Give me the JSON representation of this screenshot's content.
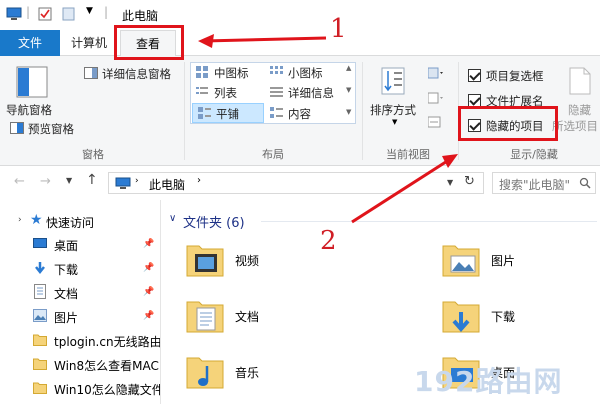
{
  "titlebar": {
    "title": "此电脑"
  },
  "tabs": {
    "file": "文件",
    "computer": "计算机",
    "view": "查看"
  },
  "ribbon": {
    "panes": {
      "nav_pane": "导航窗格",
      "preview_pane": "预览窗格",
      "details_pane": "详细信息窗格",
      "group_label": "窗格"
    },
    "layout": {
      "items": [
        "中图标",
        "小图标",
        "列表",
        "详细信息",
        "平铺",
        "内容"
      ],
      "selected": "平铺",
      "group_label": "布局"
    },
    "current_view": {
      "sort_by": "排序方式",
      "group_label": "当前视图"
    },
    "show_hide": {
      "item_checkboxes": "项目复选框",
      "file_extensions": "文件扩展名",
      "hidden_items": "隐藏的项目",
      "hide_label": "隐藏",
      "hide_selected_label": "所选项目",
      "group_label": "显示/隐藏"
    }
  },
  "address": {
    "path": "此电脑",
    "search_placeholder": "搜索\"此电脑\""
  },
  "nav": {
    "quick_access": "快速访问",
    "items": [
      {
        "label": "桌面",
        "pinned": true
      },
      {
        "label": "下载",
        "pinned": true
      },
      {
        "label": "文档",
        "pinned": true
      },
      {
        "label": "图片",
        "pinned": true
      },
      {
        "label": "tplogin.cn无线路由",
        "pinned": false
      },
      {
        "label": "Win8怎么查看MAC",
        "pinned": false
      },
      {
        "label": "Win10怎么隐藏文件",
        "pinned": false
      }
    ]
  },
  "content": {
    "folders_header": "文件夹 (6)",
    "folders": [
      "视频",
      "图片",
      "文档",
      "下载",
      "音乐",
      "桌面"
    ]
  },
  "annotations": {
    "step1": "1",
    "step2": "2"
  },
  "watermark": "192路由网",
  "colors": {
    "file_tab": "#1979ca",
    "annotation_red": "#e0141b",
    "folder_yellow": "#f5d37a",
    "selected_tile": "#cce8ff"
  }
}
